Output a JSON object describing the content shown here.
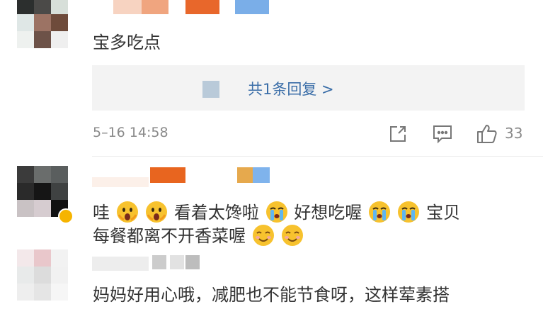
{
  "colors": {
    "link": "#3b6ea8",
    "meta_text": "#8a8a8a",
    "reply_bg": "#f3f3f3",
    "icon": "#777777"
  },
  "comment1": {
    "text": "宝多吃点",
    "reply_link": "共1条回复 >",
    "timestamp": "5–16 14:58",
    "like_count": "33"
  },
  "comment2": {
    "text_parts": [
      "哇",
      "看着太馋啦",
      "好想吃喔",
      "宝贝",
      "每餐都离不开香菜喔"
    ],
    "emojis": [
      "shocked-face-emoji",
      "crying-face-emoji",
      "smiling-face-emoji"
    ]
  },
  "comment3": {
    "text": "妈妈好用心哦，减肥也不能节食呀，这样荤素搭"
  },
  "icons": [
    "share-icon",
    "comment-icon",
    "like-icon"
  ]
}
